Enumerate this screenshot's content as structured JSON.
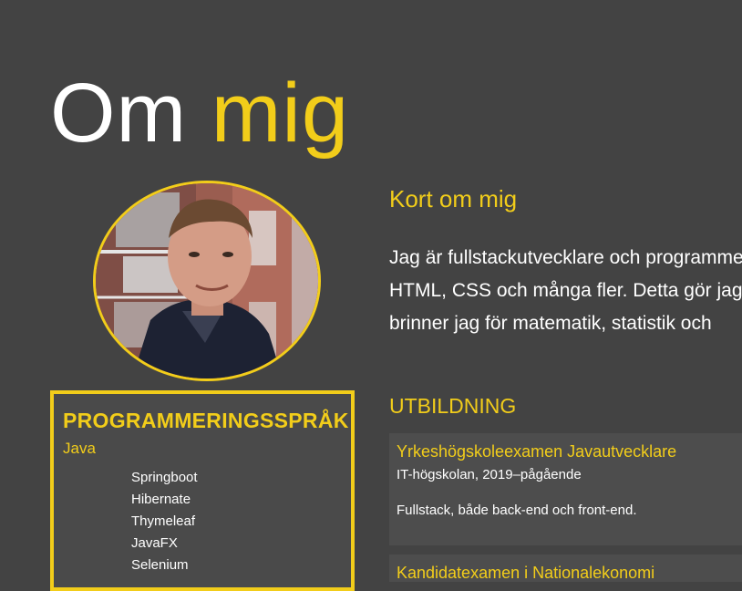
{
  "page": {
    "title_part1": "Om",
    "title_part2": "mig"
  },
  "profile": {
    "photo_alt": "Profilbild"
  },
  "about": {
    "heading": "Kort om mig",
    "lines": [
      "Jag är fullstackutvecklare och programmerar i Java,",
      "HTML, CSS och många fler. Detta gör jag för att",
      "brinner jag för matematik, statistik och"
    ]
  },
  "languages": {
    "heading": "PROGRAMMERINGSSPRÅK",
    "main": "Java",
    "items": [
      "Springboot",
      "Hibernate",
      "Thymeleaf",
      "JavaFX",
      "Selenium"
    ]
  },
  "education": {
    "heading": "UTBILDNING",
    "entries": [
      {
        "title": "Yrkeshögskoleexamen Javautvecklare",
        "meta": "IT-högskolan, 2019–pågående",
        "description": "Fullstack, både back-end och front-end."
      },
      {
        "title": "Kandidatexamen i Nationalekonomi",
        "meta": "",
        "description": ""
      }
    ]
  },
  "colors": {
    "background": "#434343",
    "accent": "#f2cd1a",
    "text": "#ffffff"
  }
}
